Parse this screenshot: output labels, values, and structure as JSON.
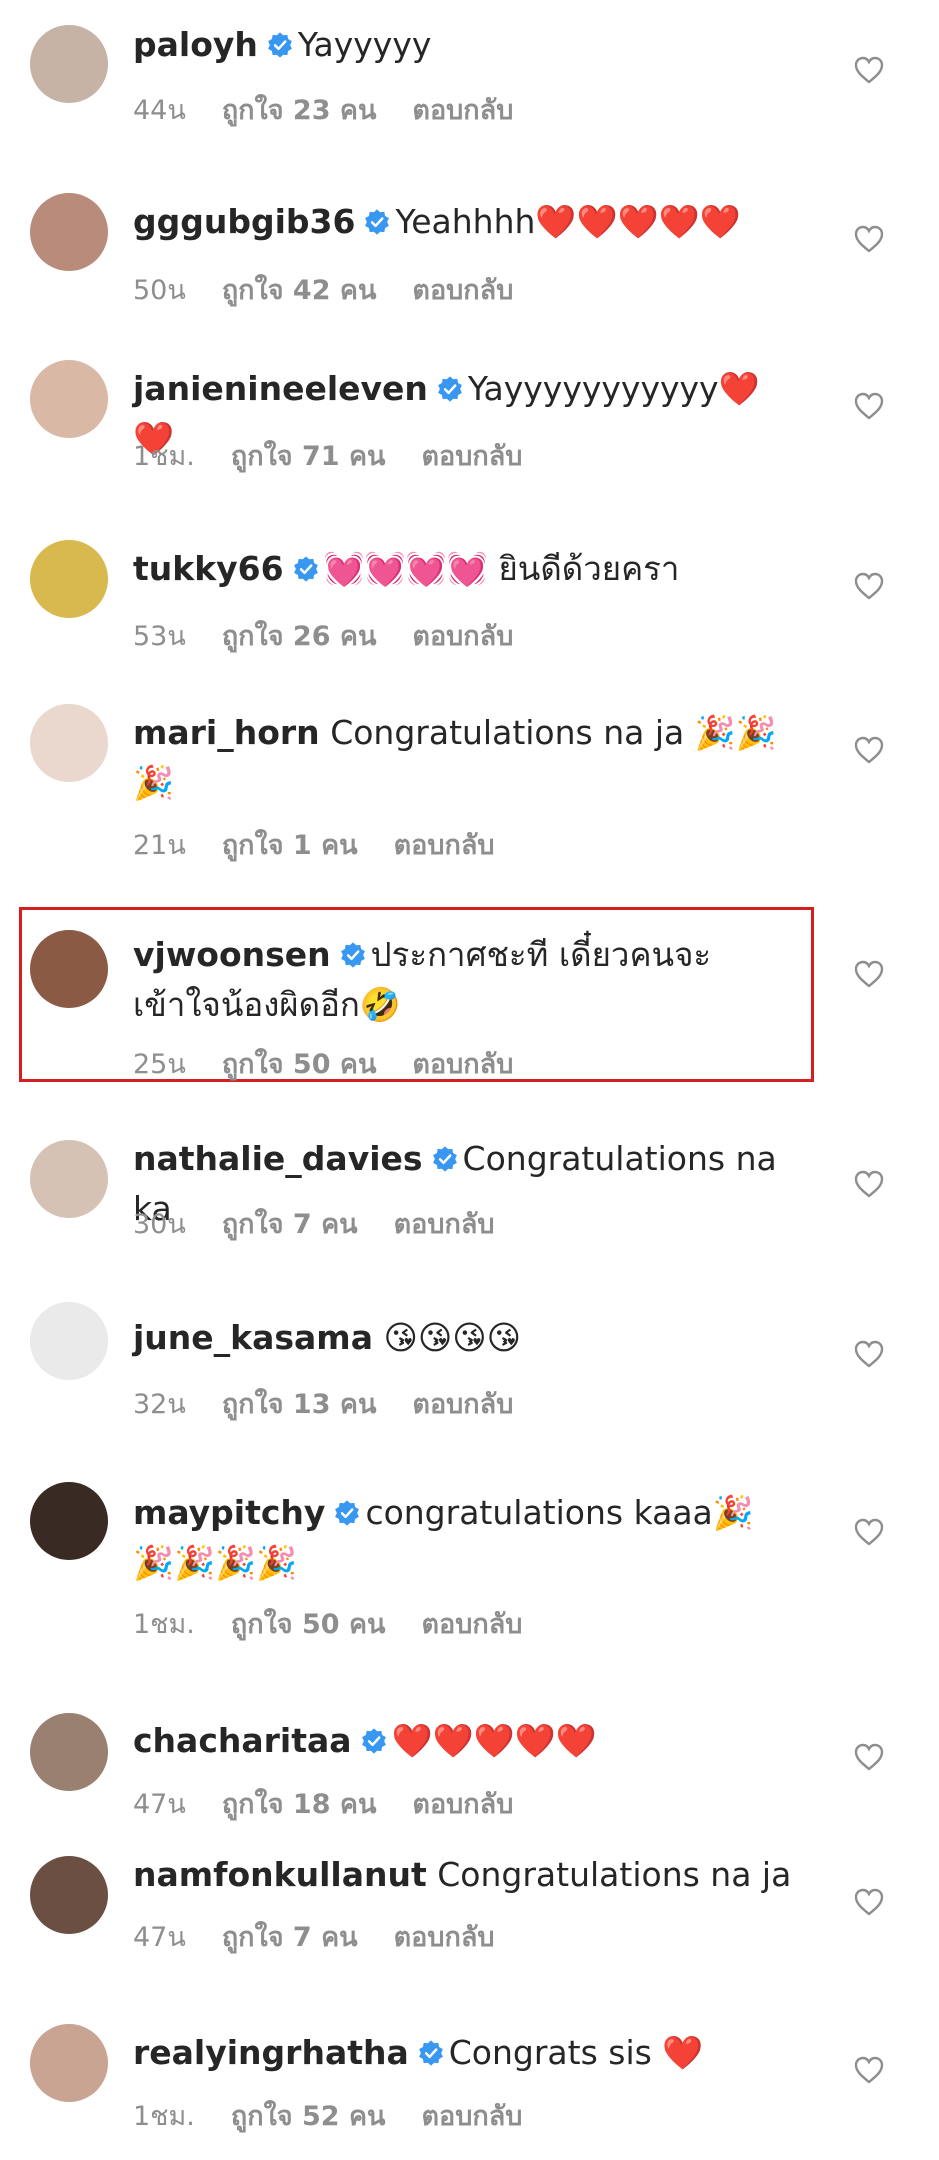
{
  "comments": [
    {
      "username": "paloyh",
      "verified": true,
      "text": "Yayyyyy",
      "time": "44น",
      "likes": "ถูกใจ 23 คน",
      "reply": "ตอบกลับ",
      "avatar_color": "#c7b3a6"
    },
    {
      "username": "gggubgib36",
      "verified": true,
      "text": "Yeahhhh❤️❤️❤️❤️❤️",
      "time": "50น",
      "likes": "ถูกใจ 42 คน",
      "reply": "ตอบกลับ",
      "avatar_color": "#b98b7a"
    },
    {
      "username": "janienineeleven",
      "verified": true,
      "text": "Yayyyyyyyyyyy❤️❤️",
      "time": "1ชม.",
      "likes": "ถูกใจ 71 คน",
      "reply": "ตอบกลับ",
      "avatar_color": "#d9b8a6"
    },
    {
      "username": "tukky66",
      "verified": true,
      "text": "💓💓💓💓 ยินดีด้วยครา",
      "time": "53น",
      "likes": "ถูกใจ 26 คน",
      "reply": "ตอบกลับ",
      "avatar_color": "#d7b94d"
    },
    {
      "username": "mari_horn",
      "verified": false,
      "text": "Congratulations na ja 🎉🎉🎉",
      "time": "21น",
      "likes": "ถูกใจ 1 คน",
      "reply": "ตอบกลับ",
      "avatar_color": "#ead8ce"
    },
    {
      "username": "vjwoonsen",
      "verified": true,
      "text": "ประกาศชะที เดี๋ยวคนจะเข้าใจน้องผิดอีก🤣",
      "time": "25น",
      "likes": "ถูกใจ 50 คน",
      "reply": "ตอบกลับ",
      "avatar_color": "#8b5a44"
    },
    {
      "username": "nathalie_davies",
      "verified": true,
      "text": "Congratulations na ka",
      "time": "30น",
      "likes": "ถูกใจ 7 คน",
      "reply": "ตอบกลับ",
      "avatar_color": "#d5c2b4"
    },
    {
      "username": "june_kasama",
      "verified": false,
      "text": "😘😘😘😘",
      "time": "32น",
      "likes": "ถูกใจ 13 คน",
      "reply": "ตอบกลับ",
      "avatar_color": "#eaeaea"
    },
    {
      "username": "maypitchy",
      "verified": true,
      "text": "congratulations kaaa🎉🎉🎉🎉🎉",
      "time": "1ชม.",
      "likes": "ถูกใจ 50 คน",
      "reply": "ตอบกลับ",
      "avatar_color": "#3a2a24"
    },
    {
      "username": "chacharitaa",
      "verified": true,
      "text": "❤️❤️❤️❤️❤️",
      "time": "47น",
      "likes": "ถูกใจ 18 คน",
      "reply": "ตอบกลับ",
      "avatar_color": "#9a8070"
    },
    {
      "username": "namfonkullanut",
      "verified": false,
      "text": "Congratulations na ja",
      "time": "47น",
      "likes": "ถูกใจ 7 คน",
      "reply": "ตอบกลับ",
      "avatar_color": "#6b4f43"
    },
    {
      "username": "realyingrhatha",
      "verified": true,
      "text": "Congrats sis ❤️",
      "time": "1ชม.",
      "likes": "ถูกใจ 52 คน",
      "reply": "ตอบกลับ",
      "avatar_color": "#c9a492"
    }
  ]
}
